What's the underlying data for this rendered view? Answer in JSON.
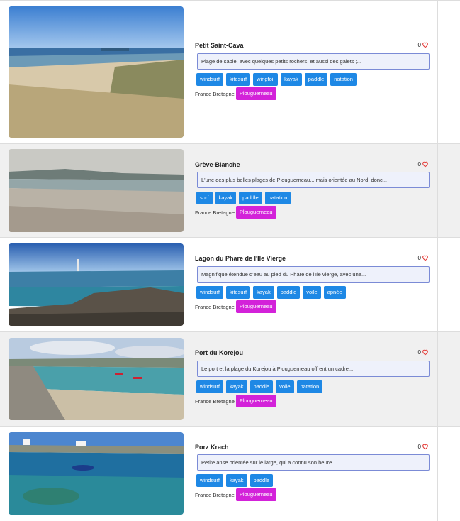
{
  "locationPrefix": "France Bretagne",
  "beaches": [
    {
      "title": "Petit Saint-Cava",
      "likes": "0",
      "description": "Plage de sable, avec quelques petits rochers, et aussi des galets ;...",
      "tags": [
        "windsurf",
        "kitesurf",
        "wingfoil",
        "kayak",
        "paddle",
        "natation"
      ],
      "city": "Plouguerneau",
      "photo": "beach-dunes"
    },
    {
      "title": "Grève-Blanche",
      "likes": "0",
      "description": "L'une des plus belles plages de Plouguerneau... mais orientée au Nord, donc...",
      "tags": [
        "surf",
        "kayak",
        "paddle",
        "natation"
      ],
      "city": "Plouguerneau",
      "photo": "sandy-beach"
    },
    {
      "title": "Lagon du Phare de l'Ile Vierge",
      "likes": "0",
      "description": "Magnifique étendue d'eau au pied du Phare de l'Ile vierge, avec une...",
      "tags": [
        "windsurf",
        "kitesurf",
        "kayak",
        "paddle",
        "voile",
        "apnée"
      ],
      "city": "Plouguerneau",
      "photo": "lighthouse-lagoon"
    },
    {
      "title": "Port du Korejou",
      "likes": "0",
      "description": "Le port et la plage du Korejou à Plouguerneau offrent un cadre...",
      "tags": [
        "windsurf",
        "kayak",
        "paddle",
        "voile",
        "natation"
      ],
      "city": "Plouguerneau",
      "photo": "harbor"
    },
    {
      "title": "Porz Krach",
      "likes": "0",
      "description": "Petite anse orientée sur le large, qui a connu son heure...",
      "tags": [
        "windsurf",
        "kayak",
        "paddle"
      ],
      "city": "Plouguerneau",
      "photo": "cove-boat"
    }
  ]
}
